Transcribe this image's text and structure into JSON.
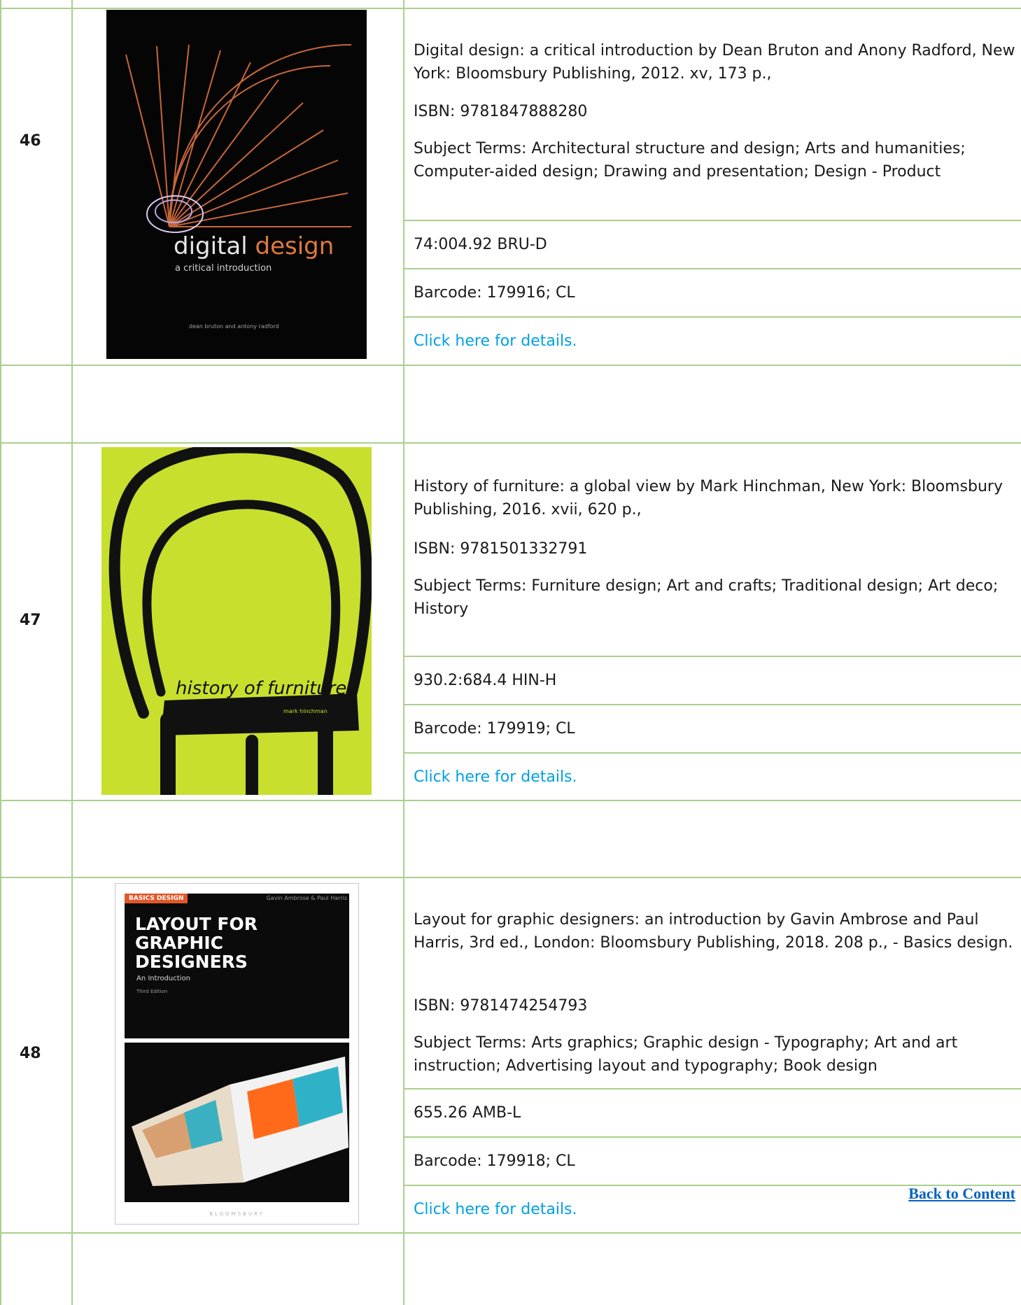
{
  "entries": [
    {
      "number": "46",
      "description": "Digital design: a critical introduction by Dean Bruton and Anony Radford, New York: Bloomsbury Publishing, 2012. xv, 173 p.,",
      "isbn": "ISBN: 9781847888280",
      "subjects": "Subject Terms: Architectural structure and design; Arts and humanities; Computer-aided design; Drawing and presentation; Design - Product",
      "call_number": "74:004.92 BRU-D",
      "barcode": "Barcode: 179916; CL",
      "link": "Click here for details.",
      "cover": {
        "title": "digital design",
        "subtitle": "a critical introduction",
        "authors": "dean bruton and antony radford"
      }
    },
    {
      "number": "47",
      "description": "History of furniture: a global view by Mark Hinchman, New York: Bloomsbury Publishing, 2016. xvii, 620 p.,",
      "isbn": "ISBN: 9781501332791",
      "subjects": "Subject Terms: Furniture design; Art and crafts; Traditional design; Art deco; History",
      "call_number": "930.2:684.4 HIN-H",
      "barcode": "Barcode: 179919; CL",
      "link": "Click here for details.",
      "cover": {
        "title": "history of furniture",
        "author": "mark hinchman"
      }
    },
    {
      "number": "48",
      "description": "Layout for graphic designers: an introduction by Gavin Ambrose and Paul Harris, 3rd ed., London: Bloomsbury Publishing, 2018. 208 p., - Basics design.",
      "isbn": "ISBN: 9781474254793",
      "subjects": "Subject Terms: Arts graphics; Graphic design - Typography; Art and art instruction; Advertising layout and typography; Book design",
      "call_number": "655.26 AMB-L",
      "barcode": "Barcode: 179918; CL",
      "link": "Click here for details.",
      "cover": {
        "series": "BASICS DESIGN",
        "authors": "Gavin Ambrose & Paul Harris",
        "title_1": "LAYOUT FOR",
        "title_2": "GRAPHIC",
        "title_3": "DESIGNERS",
        "subtitle": "An Introduction",
        "edition": "Third Edition",
        "publisher": "BLOOMSBURY"
      }
    }
  ],
  "back_link": "Back to Content",
  "colors": {
    "grid": "#a9d08e",
    "link": "#00a0e3",
    "back_link": "#0563c1"
  }
}
